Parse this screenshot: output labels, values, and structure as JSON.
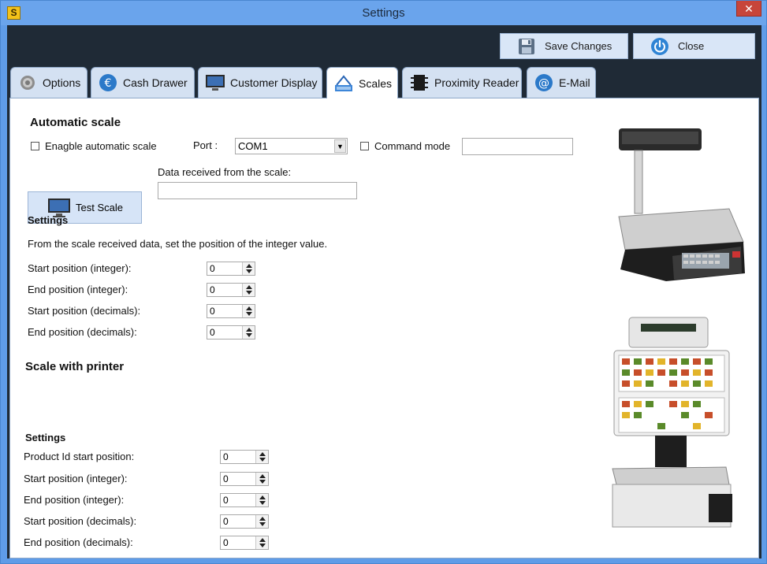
{
  "window": {
    "title": "Settings",
    "app_icon": "S",
    "close_glyph": "✕"
  },
  "toolbar": {
    "save_label": "Save Changes",
    "close_label": "Close"
  },
  "tabs": [
    {
      "label": "Options",
      "icon": "gear-icon"
    },
    {
      "label": "Cash Drawer",
      "icon": "euro-icon"
    },
    {
      "label": "Customer Display",
      "icon": "monitor-icon"
    },
    {
      "label": "Scales",
      "icon": "scale-icon",
      "active": true
    },
    {
      "label": "Proximity Reader",
      "icon": "chip-icon"
    },
    {
      "label": "E-Mail",
      "icon": "at-icon"
    }
  ],
  "automatic": {
    "heading": "Automatic scale",
    "enable_label": "Enagble automatic scale",
    "enable_checked": false,
    "port_label": "Port :",
    "port_value": "COM1",
    "command_label": "Command mode",
    "command_checked": false,
    "command_value": "",
    "test_label": "Test Scale",
    "received_label": "Data received from the scale:",
    "received_value": "",
    "settings_heading": "Settings",
    "description": "From the scale received data, set the position of the integer value.",
    "fields": [
      {
        "label": "Start position (integer):",
        "value": "0"
      },
      {
        "label": "End position (integer):",
        "value": "0"
      },
      {
        "label": "Start position (decimals):",
        "value": "0"
      },
      {
        "label": "End position (decimals):",
        "value": "0"
      }
    ]
  },
  "printer": {
    "heading": "Scale with printer",
    "settings_heading": "Settings",
    "fields": [
      {
        "label": "Product Id start position:",
        "value": "0"
      },
      {
        "label": "Start position (integer):",
        "value": "0"
      },
      {
        "label": "End position (integer):",
        "value": "0"
      },
      {
        "label": "Start position (decimals):",
        "value": "0"
      },
      {
        "label": "End position (decimals):",
        "value": "0"
      }
    ]
  }
}
